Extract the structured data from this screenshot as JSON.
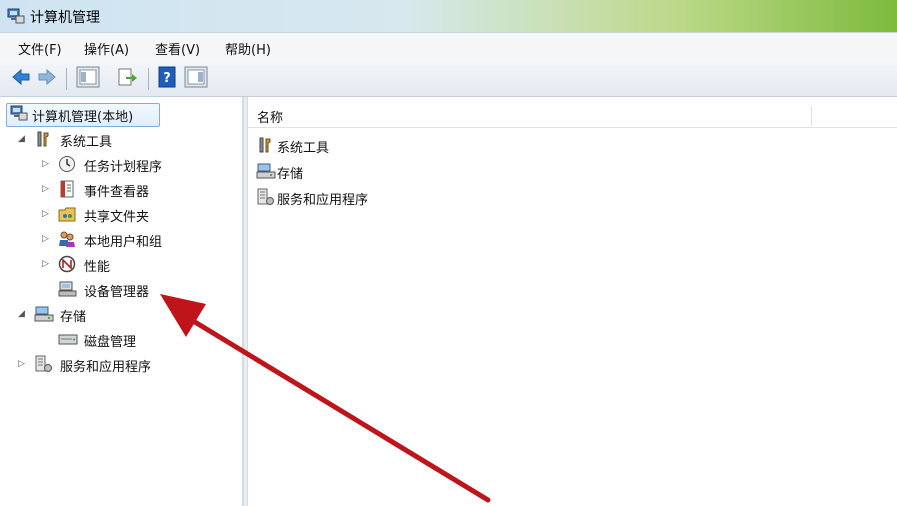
{
  "window": {
    "title": "计算机管理"
  },
  "menu": [
    "文件(F)",
    "操作(A)",
    "查看(V)",
    "帮助(H)"
  ],
  "tree": {
    "root": "计算机管理(本地)",
    "system_tools": "系统工具",
    "task_scheduler": "任务计划程序",
    "event_viewer": "事件查看器",
    "shared_folders": "共享文件夹",
    "local_users": "本地用户和组",
    "performance": "性能",
    "device_manager": "设备管理器",
    "storage": "存储",
    "disk_management": "磁盘管理",
    "services_apps": "服务和应用程序"
  },
  "list": {
    "column_name": "名称",
    "items": [
      "系统工具",
      "存储",
      "服务和应用程序"
    ]
  },
  "colors": {
    "arrow": "#c0141b",
    "selection": "#84acdd"
  }
}
